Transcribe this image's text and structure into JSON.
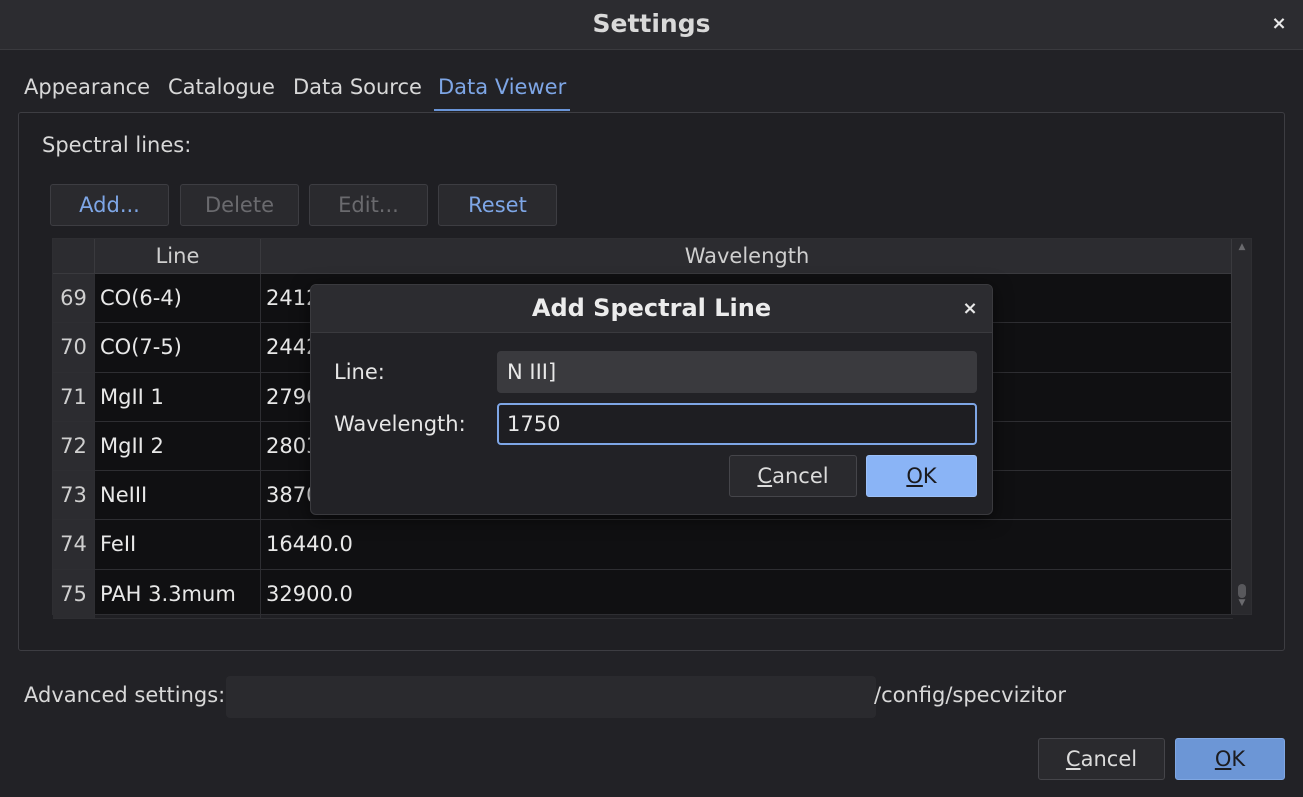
{
  "window": {
    "title": "Settings",
    "close_glyph": "×"
  },
  "tabs": [
    {
      "label": "Appearance",
      "active": false
    },
    {
      "label": "Catalogue",
      "active": false
    },
    {
      "label": "Data Source",
      "active": false
    },
    {
      "label": "Data Viewer",
      "active": true
    }
  ],
  "spectral": {
    "section_label": "Spectral lines:",
    "buttons": {
      "add": "Add...",
      "delete": "Delete",
      "edit": "Edit...",
      "reset": "Reset"
    },
    "columns": {
      "line": "Line",
      "wavelength": "Wavelength"
    },
    "rows": [
      {
        "num": "69",
        "line": "CO(6-4)",
        "wavelength": "2412"
      },
      {
        "num": "70",
        "line": "CO(7-5)",
        "wavelength": "2442"
      },
      {
        "num": "71",
        "line": "MgII 1",
        "wavelength": "2796"
      },
      {
        "num": "72",
        "line": "MgII 2",
        "wavelength": "2803"
      },
      {
        "num": "73",
        "line": "NeIII",
        "wavelength": "3870"
      },
      {
        "num": "74",
        "line": "FeII",
        "wavelength": "16440.0"
      },
      {
        "num": "75",
        "line": "PAH 3.3mum",
        "wavelength": "32900.0"
      }
    ]
  },
  "advanced": {
    "label": "Advanced settings:",
    "path": "/config/specvizitor"
  },
  "footer": {
    "cancel_mnemonic": "C",
    "cancel_rest": "ancel",
    "ok_mnemonic": "O",
    "ok_rest": "K"
  },
  "dialog": {
    "title": "Add Spectral Line",
    "close_glyph": "×",
    "line_label": "Line:",
    "line_value": "N III]",
    "wavelength_label": "Wavelength:",
    "wavelength_value": "1750",
    "cancel_mnemonic": "C",
    "cancel_rest": "ancel",
    "ok_mnemonic": "O",
    "ok_rest": "K"
  },
  "colors": {
    "accent": "#7ea6e6",
    "background": "#222226",
    "ok_button": "#6c96d6"
  },
  "icons": {
    "window_close": "close-icon",
    "dialog_close": "close-icon"
  }
}
